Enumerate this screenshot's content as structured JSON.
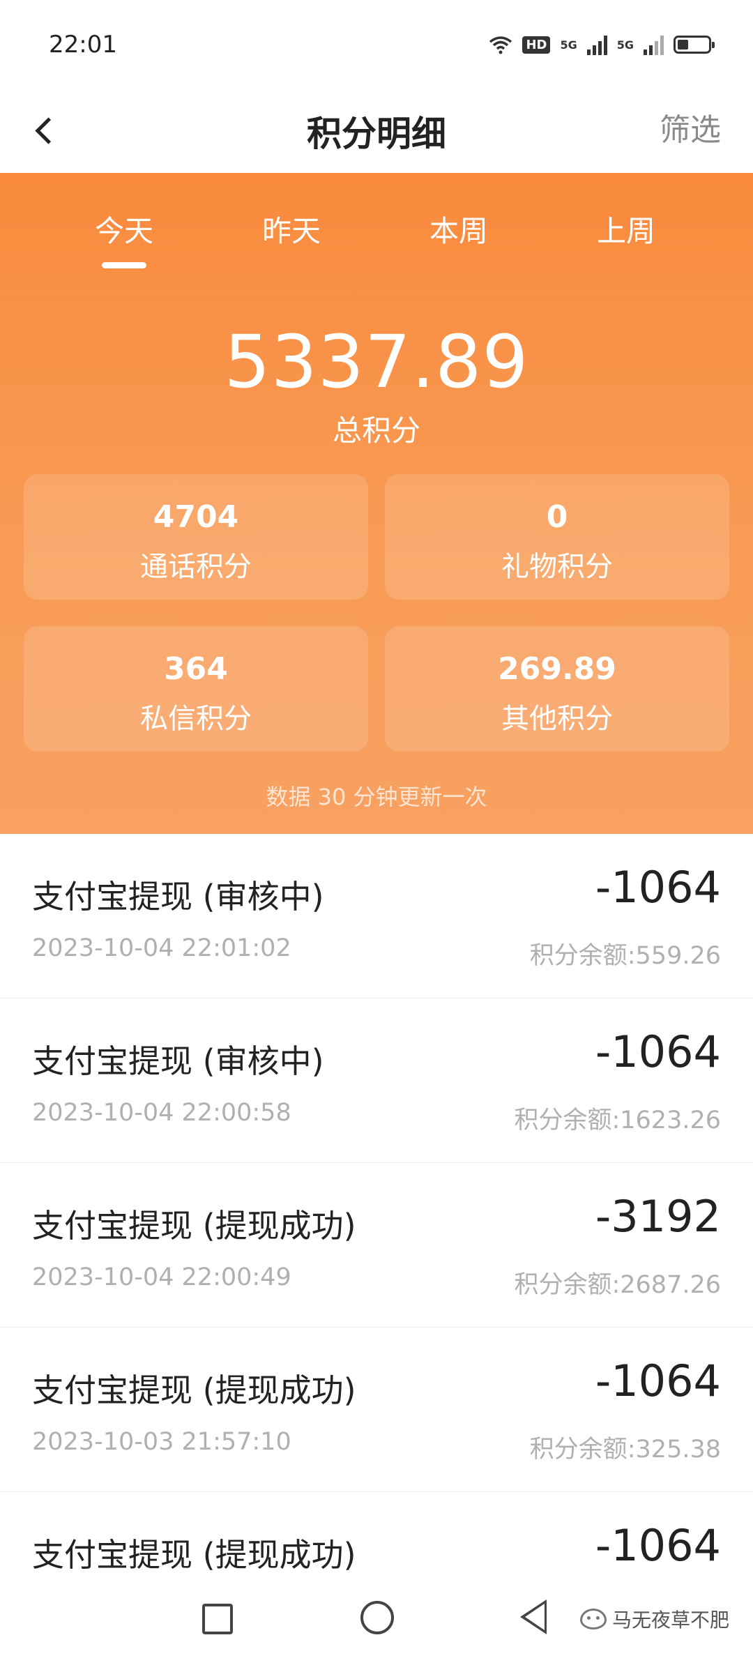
{
  "status_bar": {
    "time": "22:01",
    "hd": "HD",
    "net1": "5G",
    "net2": "5G",
    "battery_level": 0.35
  },
  "header": {
    "title": "积分明细",
    "filter_label": "筛选"
  },
  "tabs": [
    {
      "label": "今天",
      "active": true
    },
    {
      "label": "昨天",
      "active": false
    },
    {
      "label": "本周",
      "active": false
    },
    {
      "label": "上周",
      "active": false
    }
  ],
  "summary": {
    "total_value": "5337.89",
    "total_label": "总积分",
    "cards": [
      {
        "value": "4704",
        "label": "通话积分"
      },
      {
        "value": "0",
        "label": "礼物积分"
      },
      {
        "value": "364",
        "label": "私信积分"
      },
      {
        "value": "269.89",
        "label": "其他积分"
      }
    ],
    "update_note": "数据 30 分钟更新一次"
  },
  "records": [
    {
      "title": "支付宝提现 (审核中)",
      "time": "2023-10-04 22:01:02",
      "amount": "-1064",
      "balance": "积分余额:559.26"
    },
    {
      "title": "支付宝提现 (审核中)",
      "time": "2023-10-04 22:00:58",
      "amount": "-1064",
      "balance": "积分余额:1623.26"
    },
    {
      "title": "支付宝提现 (提现成功)",
      "time": "2023-10-04 22:00:49",
      "amount": "-3192",
      "balance": "积分余额:2687.26"
    },
    {
      "title": "支付宝提现 (提现成功)",
      "time": "2023-10-03 21:57:10",
      "amount": "-1064",
      "balance": "积分余额:325.38"
    },
    {
      "title": "支付宝提现 (提现成功)",
      "time": "",
      "amount": "-1064",
      "balance": ""
    }
  ],
  "watermark": {
    "text": "马无夜草不肥"
  },
  "colors": {
    "accent": "#f98a3c",
    "accent_light": "#f8a162",
    "muted_text": "#b0b0b0"
  }
}
